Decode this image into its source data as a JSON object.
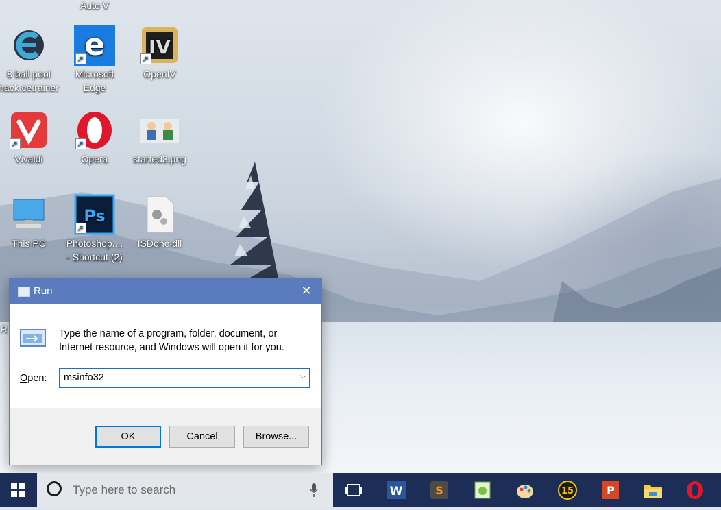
{
  "desktop": {
    "top_partial_label": "Auto V",
    "icons": [
      {
        "label_line1": "8 ball pool",
        "label_line2": "hack.cetrainer",
        "icon": "cheat-engine-icon"
      },
      {
        "label_line1": "Microsoft",
        "label_line2": "Edge",
        "icon": "edge-icon"
      },
      {
        "label_line1": "OpenIV",
        "label_line2": "",
        "icon": "openiv-icon"
      },
      {
        "label_line1": "Vivaldi",
        "label_line2": "",
        "icon": "vivaldi-icon"
      },
      {
        "label_line1": "Opera",
        "label_line2": "",
        "icon": "opera-icon"
      },
      {
        "label_line1": "started3.png",
        "label_line2": "",
        "icon": "image-file-icon"
      },
      {
        "label_line1": "This PC",
        "label_line2": "",
        "icon": "computer-icon"
      },
      {
        "label_line1": "Photoshop....",
        "label_line2": "- Shortcut (2)",
        "icon": "photoshop-icon"
      },
      {
        "label_line1": "ISDone.dll",
        "label_line2": "",
        "icon": "dll-file-icon"
      }
    ],
    "partial_left_label": "R"
  },
  "run_dialog": {
    "title": "Run",
    "close_glyph": "✕",
    "description": "Type the name of a program, folder, document, or Internet resource, and Windows will open it for you.",
    "open_label_accel": "O",
    "open_label_rest": "pen:",
    "input_value": "msinfo32",
    "ok_label": "OK",
    "cancel_label": "Cancel",
    "browse_label": "Browse..."
  },
  "taskbar": {
    "search_placeholder": "Type here to search",
    "pinned": [
      "task-view-icon",
      "word-icon",
      "sublime-text-icon",
      "notepad-plus-plus-icon",
      "paint-icon",
      "app-15-icon",
      "powerpoint-icon",
      "file-explorer-icon",
      "opera-icon"
    ],
    "badge_15": "15"
  },
  "colors": {
    "titlebar": "#5a7cbf",
    "taskbar": "#1c2e57",
    "accent": "#0078d7"
  }
}
